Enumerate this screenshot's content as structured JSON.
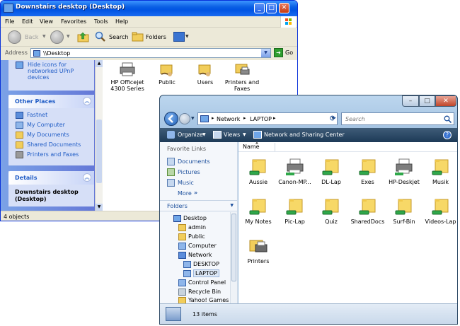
{
  "xp": {
    "title": "Downstairs desktop (Desktop)",
    "buttons": {
      "minimize": "_",
      "maximize": "□",
      "close": "✕"
    },
    "menu": [
      "File",
      "Edit",
      "View",
      "Favorites",
      "Tools",
      "Help"
    ],
    "toolbar": {
      "back": "Back",
      "search": "Search",
      "folders": "Folders"
    },
    "address": {
      "label": "Address",
      "value": "\\\\Desktop",
      "go": "Go"
    },
    "network_tasks": {
      "item": "Hide icons for networked UPnP devices"
    },
    "other_places": {
      "title": "Other Places",
      "items": [
        "Fastnet",
        "My Computer",
        "My Documents",
        "Shared Documents",
        "Printers and Faxes"
      ]
    },
    "details": {
      "title": "Details",
      "name": "Downstairs desktop (Desktop)"
    },
    "items": [
      "HP Officejet 4300 Series",
      "Public",
      "Users",
      "Printers and Faxes"
    ],
    "status": "4 objects"
  },
  "vista": {
    "buttons": {
      "minimize": "–",
      "maximize": "□",
      "close": "✕"
    },
    "breadcrumb": [
      "Network",
      "LAPTOP"
    ],
    "search_placeholder": "Search",
    "commands": {
      "organize": "Organize",
      "views": "Views",
      "network_center": "Network and Sharing Center"
    },
    "favorite_links": {
      "title": "Favorite Links",
      "items": [
        "Documents",
        "Pictures",
        "Music"
      ],
      "more": "More"
    },
    "folders": {
      "title": "Folders",
      "items": [
        "Desktop",
        "admin",
        "Public",
        "Computer",
        "Network",
        "DESKTOP",
        "LAPTOP",
        "Control Panel",
        "Recycle Bin",
        "Yahoo! Games"
      ]
    },
    "column": "Name",
    "items": [
      "Aussie",
      "Canon-MP...",
      "DL-Lap",
      "Exes",
      "HP-Deskjet",
      "Musik",
      "My Notes",
      "Pic-Lap",
      "Quiz",
      "SharedDocs",
      "Surf-Bin",
      "Videos-Lap",
      "Printers"
    ],
    "status": "13 items"
  }
}
